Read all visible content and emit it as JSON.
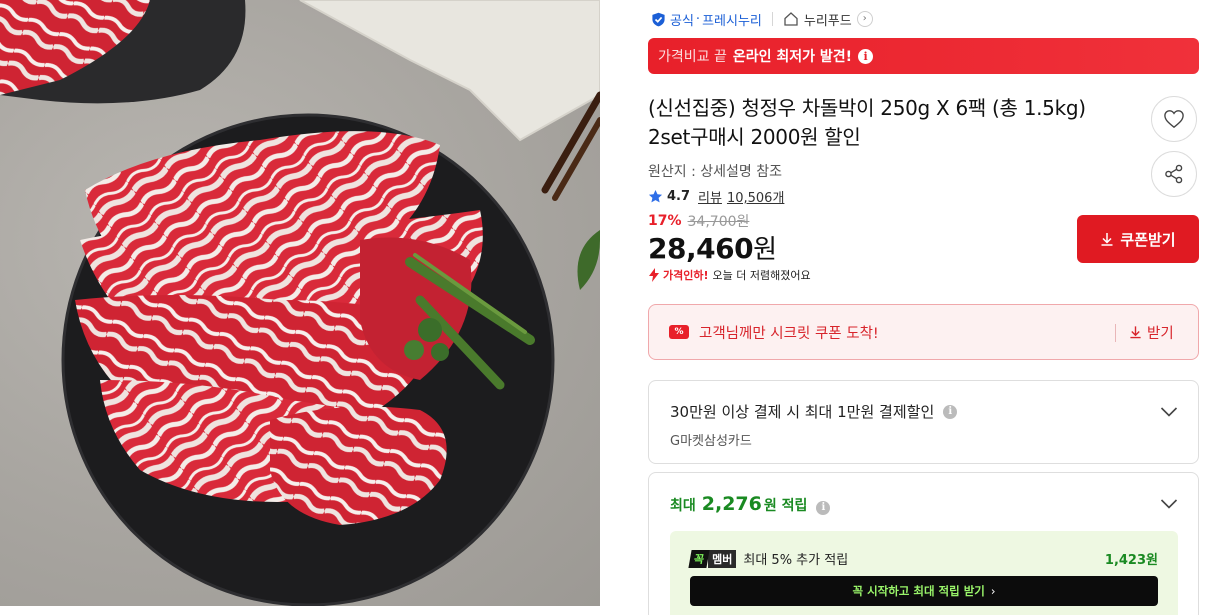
{
  "product_image": {
    "alt": ""
  },
  "seller": {
    "official_label": "공식",
    "official_dot": "·",
    "seller_name": "프레시누리",
    "store_name": "누리푸드"
  },
  "banner": {
    "prefix": "가격비교 끝",
    "highlight": "온라인 최저가 발견!",
    "info_glyph": "i"
  },
  "product": {
    "title": "(신선집중) 청정우 차돌박이 250g X 6팩 (총 1.5kg) 2set구매시 2000원 할인",
    "origin": "원산지 : 상세설명 참조",
    "rating": "4.7",
    "review_label": "리뷰",
    "review_count": "10,506개",
    "discount_pct": "17%",
    "original_price": "34,700원",
    "price_number": "28,460",
    "price_unit": "원",
    "price_drop_tag": "가격인하!",
    "price_drop_text": "오늘 더 저렴해졌어요"
  },
  "buttons": {
    "coupon": "쿠폰받기"
  },
  "secret_coupon": {
    "tag": "%",
    "text": "고객님께만 시크릿 쿠폰 도착!",
    "get": "받기"
  },
  "payment_card": {
    "title": "30만원 이상 결제 시 최대 1만원 결제할인",
    "sub": "G마켓삼성카드"
  },
  "points_card": {
    "prefix": "최대",
    "amount": "2,276",
    "suffix": "원 적립",
    "member_logo_a": "꼭",
    "member_logo_b": "멤버",
    "member_text": "최대 5% 추가 적립",
    "member_amount": "1,423원",
    "cta": "꼭 시작하고 최대 적립 받기",
    "cta_arrow": "›"
  },
  "colors": {
    "accent_red": "#e01a22",
    "official_blue": "#1b5fd6",
    "point_green": "#1a8a22"
  },
  "icons": [
    "shield-check-icon",
    "home-icon",
    "chevron-right-icon",
    "info-icon",
    "heart-icon",
    "share-icon",
    "star-icon",
    "download-icon",
    "lightning-icon",
    "chevron-down-icon"
  ]
}
